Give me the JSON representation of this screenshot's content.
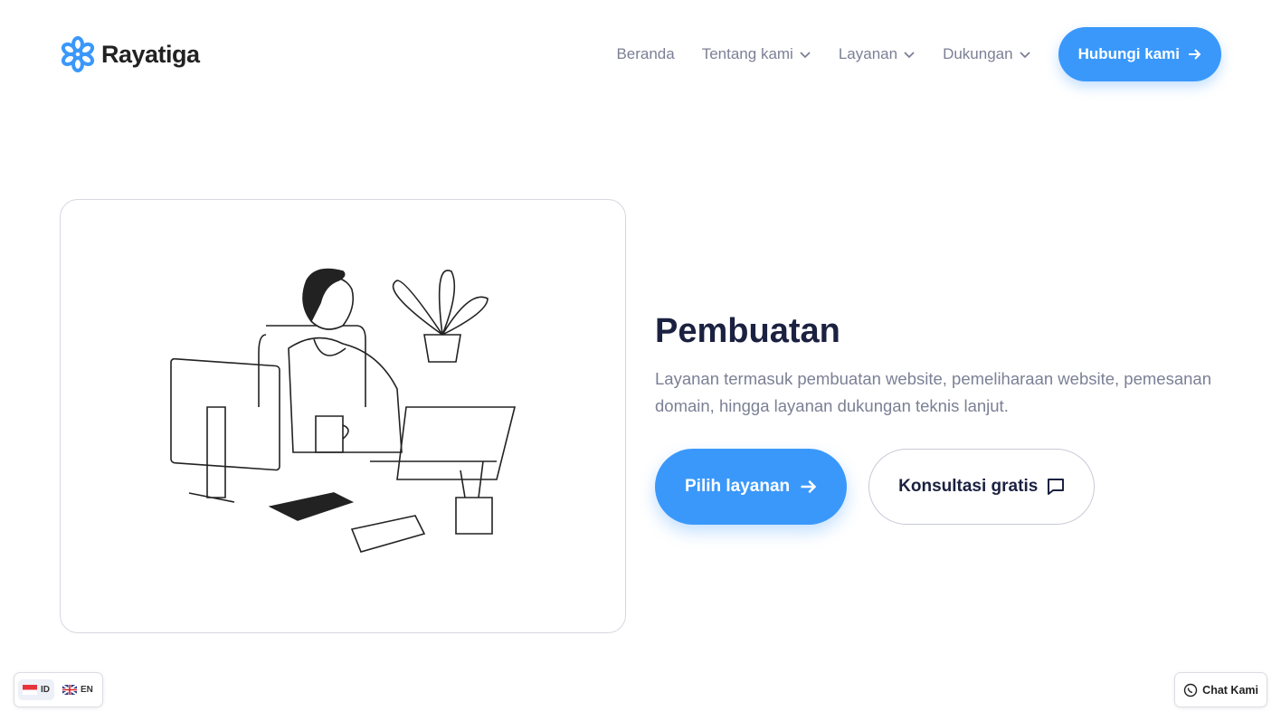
{
  "brand": {
    "name": "Rayatiga",
    "color": "#3a98fb"
  },
  "nav": {
    "items": [
      {
        "label": "Beranda"
      },
      {
        "label": "Tentang kami"
      },
      {
        "label": "Layanan"
      },
      {
        "label": "Dukungan"
      }
    ],
    "cta": "Hubungi kami"
  },
  "hero": {
    "title": "Pembuatan",
    "description": "Layanan termasuk pembuatan website, pemeliharaan website, pemesanan domain, hingga layanan dukungan teknis lanjut.",
    "primary": "Pilih layanan",
    "secondary": "Konsultasi gratis"
  },
  "lang": {
    "id": "ID",
    "en": "EN"
  },
  "chat": "Chat Kami"
}
